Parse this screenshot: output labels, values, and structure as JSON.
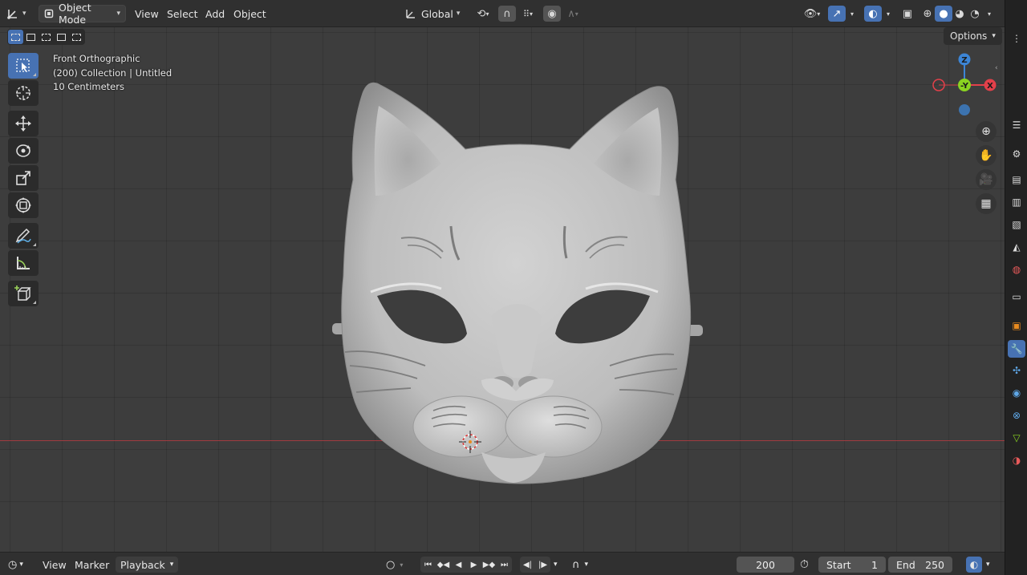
{
  "header": {
    "editor_type_icon": "axis-editor-icon",
    "mode_label": "Object Mode",
    "menus": [
      "View",
      "Select",
      "Add",
      "Object"
    ],
    "transform_orientation": "Global",
    "options_label": "Options"
  },
  "viewport": {
    "view_name": "Front Orthographic",
    "collection_info": "(200) Collection | Untitled",
    "scale_info": "10 Centimeters",
    "gizmo": {
      "z_label": "Z",
      "y_label": "-Y",
      "x_label": "X"
    }
  },
  "toolbar": {
    "tools": [
      "select-box",
      "cursor",
      "move",
      "rotate",
      "scale",
      "transform",
      "annotate",
      "measure",
      "add-cube"
    ]
  },
  "timeline": {
    "menus": [
      "View",
      "Marker",
      "Playback"
    ],
    "current_frame": "200",
    "start_label": "Start",
    "start_value": "1",
    "end_label": "End",
    "end_value": "250"
  },
  "colors": {
    "accent": "#4772b3",
    "x_axis": "#e4404a",
    "y_axis": "#8ad321",
    "z_axis": "#3c85d6",
    "viewport_bg": "#3d3d3d"
  }
}
